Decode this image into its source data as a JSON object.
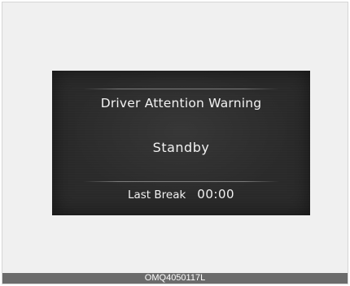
{
  "display": {
    "title": "Driver Attention Warning",
    "status": "Standby",
    "last_break_label": "Last Break",
    "last_break_value": "00:00"
  },
  "caption": {
    "code": "OMQ4050117L"
  },
  "colors": {
    "screen_background": "#2a2a2a",
    "text": "#f2f2f2",
    "caption_bar": "#6b6b6b",
    "page_background": "#f0f0f0"
  }
}
